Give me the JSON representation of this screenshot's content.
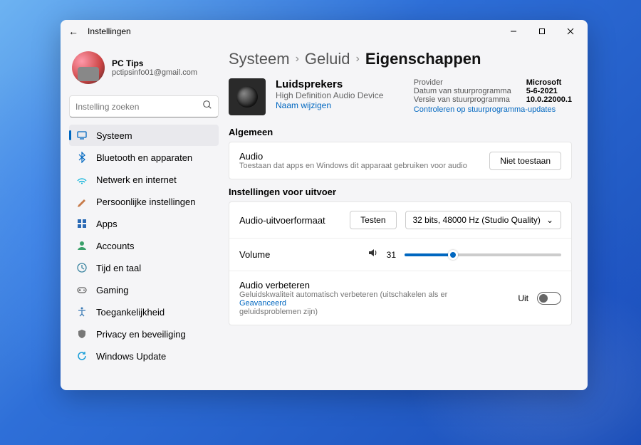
{
  "window": {
    "title": "Instellingen"
  },
  "profile": {
    "name": "PC Tips",
    "email": "pctipsinfo01@gmail.com"
  },
  "search": {
    "placeholder": "Instelling zoeken"
  },
  "nav": [
    {
      "icon": "system",
      "label": "Systeem",
      "color": "#0067c0",
      "active": true
    },
    {
      "icon": "bluetooth",
      "label": "Bluetooth en apparaten",
      "color": "#0067c0"
    },
    {
      "icon": "network",
      "label": "Netwerk en internet",
      "color": "#00b0d8"
    },
    {
      "icon": "personalize",
      "label": "Persoonlijke instellingen",
      "color": "#c77b4a"
    },
    {
      "icon": "apps",
      "label": "Apps",
      "color": "#2a6ab5"
    },
    {
      "icon": "accounts",
      "label": "Accounts",
      "color": "#3aa06a"
    },
    {
      "icon": "time",
      "label": "Tijd en taal",
      "color": "#3a84a0"
    },
    {
      "icon": "gaming",
      "label": "Gaming",
      "color": "#666"
    },
    {
      "icon": "accessibility",
      "label": "Toegankelijkheid",
      "color": "#3a7ab5"
    },
    {
      "icon": "privacy",
      "label": "Privacy en beveiliging",
      "color": "#777"
    },
    {
      "icon": "update",
      "label": "Windows Update",
      "color": "#1a9ed8"
    }
  ],
  "breadcrumb": {
    "system": "Systeem",
    "sound": "Geluid",
    "current": "Eigenschappen"
  },
  "device": {
    "name": "Luidsprekers",
    "subtitle": "High Definition Audio Device",
    "rename": "Naam wijzigen"
  },
  "meta": {
    "provider_k": "Provider",
    "provider_v": "Microsoft",
    "date_k": "Datum van stuurprogramma",
    "date_v": "5-6-2021",
    "version_k": "Versie van stuurprogramma",
    "version_v": "10.0.22000.1",
    "check_updates": "Controleren op stuurprogramma-updates"
  },
  "sections": {
    "general": "Algemeen",
    "output": "Instellingen voor uitvoer"
  },
  "audio_allow": {
    "title": "Audio",
    "sub": "Toestaan dat apps en Windows dit apparaat gebruiken voor audio",
    "btn": "Niet toestaan"
  },
  "format": {
    "label": "Audio-uitvoerformaat",
    "test": "Testen",
    "value": "32 bits, 48000 Hz (Studio Quality)"
  },
  "volume": {
    "label": "Volume",
    "value": 31
  },
  "enhance": {
    "title": "Audio verbeteren",
    "sub_a": "Geluidskwaliteit automatisch verbeteren (uitschakelen als er",
    "advanced": "Geavanceerd",
    "sub_b": "geluidsproblemen zijn)",
    "state": "Uit"
  }
}
